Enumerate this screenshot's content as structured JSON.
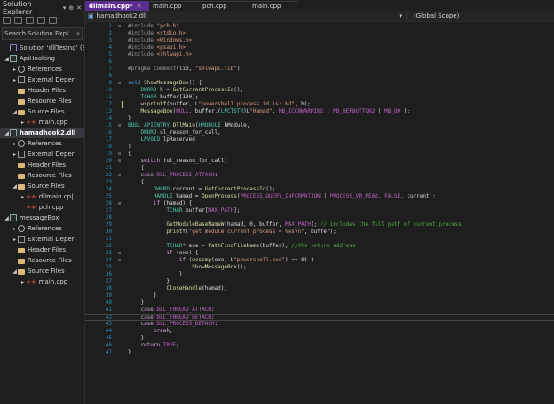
{
  "solution_explorer": {
    "title": "Solution Explorer",
    "title_buttons": [
      "▾",
      "⊕",
      "✕"
    ],
    "search_placeholder": "Search Solution Expl",
    "items": [
      {
        "label": "Solution 'dllTestng' (3",
        "indent": 0,
        "arrow": "",
        "icon": "solution",
        "sel": false
      },
      {
        "label": "ApiHooking",
        "indent": 0,
        "arrow": "◢",
        "icon": "project",
        "sel": false
      },
      {
        "label": "References",
        "indent": 1,
        "arrow": "▸",
        "icon": "ref",
        "sel": false
      },
      {
        "label": "External Deper",
        "indent": 1,
        "arrow": "▸",
        "icon": "ext",
        "sel": false
      },
      {
        "label": "Header Files",
        "indent": 1,
        "arrow": "",
        "icon": "folder",
        "sel": false
      },
      {
        "label": "Resource Files",
        "indent": 1,
        "arrow": "",
        "icon": "folder",
        "sel": false
      },
      {
        "label": "Source Files",
        "indent": 1,
        "arrow": "◢",
        "icon": "folder",
        "sel": false
      },
      {
        "label": "main.cpp",
        "indent": 2,
        "arrow": "▸",
        "icon": "cpp",
        "sel": false
      },
      {
        "label": "hamadhook2.dll",
        "indent": 0,
        "arrow": "◢",
        "icon": "project",
        "sel": true,
        "bold": true
      },
      {
        "label": "References",
        "indent": 1,
        "arrow": "▸",
        "icon": "ref",
        "sel": false
      },
      {
        "label": "External Deper",
        "indent": 1,
        "arrow": "▸",
        "icon": "ext",
        "sel": false
      },
      {
        "label": "Header Files",
        "indent": 1,
        "arrow": "",
        "icon": "folder",
        "sel": false
      },
      {
        "label": "Resource Files",
        "indent": 1,
        "arrow": "",
        "icon": "folder",
        "sel": false
      },
      {
        "label": "Source Files",
        "indent": 1,
        "arrow": "◢",
        "icon": "folder",
        "sel": false
      },
      {
        "label": "dllmain.cp|",
        "indent": 2,
        "arrow": "▸",
        "icon": "cpp",
        "sel": false
      },
      {
        "label": "pch.cpp",
        "indent": 2,
        "arrow": "",
        "icon": "cpp",
        "sel": false
      },
      {
        "label": "messageBox",
        "indent": 0,
        "arrow": "◢",
        "icon": "project",
        "sel": false
      },
      {
        "label": "References",
        "indent": 1,
        "arrow": "▸",
        "icon": "ref",
        "sel": false
      },
      {
        "label": "External Deper",
        "indent": 1,
        "arrow": "▸",
        "icon": "ext",
        "sel": false
      },
      {
        "label": "Header Files",
        "indent": 1,
        "arrow": "",
        "icon": "folder",
        "sel": false
      },
      {
        "label": "Resource Files",
        "indent": 1,
        "arrow": "",
        "icon": "folder",
        "sel": false
      },
      {
        "label": "Source Files",
        "indent": 1,
        "arrow": "◢",
        "icon": "folder",
        "sel": false
      },
      {
        "label": "main.cpp",
        "indent": 2,
        "arrow": "▸",
        "icon": "cpp",
        "sel": false
      }
    ]
  },
  "tabs": [
    {
      "label": "dllmain.cpp*",
      "active": true
    },
    {
      "label": "main.cpp",
      "active": false
    },
    {
      "label": "pch.cpp",
      "active": false
    },
    {
      "label": "main.cpp",
      "active": false
    }
  ],
  "navbar": {
    "file": "hamadhook2.dll",
    "scope": "(Global Scope)"
  },
  "lines": [
    {
      "n": 1,
      "fold": "⊟",
      "tokens": [
        [
          "p",
          "#include "
        ],
        [
          "s",
          "\"pch.h\""
        ]
      ]
    },
    {
      "n": 2,
      "tokens": [
        [
          "p",
          "#include "
        ],
        [
          "s",
          "<stdio.h>"
        ]
      ]
    },
    {
      "n": 3,
      "tokens": [
        [
          "p",
          "#include "
        ],
        [
          "s",
          "<Windows.h>"
        ]
      ]
    },
    {
      "n": 4,
      "tokens": [
        [
          "p",
          "#include "
        ],
        [
          "s",
          "<psapi.h>"
        ]
      ]
    },
    {
      "n": 5,
      "tokens": [
        [
          "p",
          "#include "
        ],
        [
          "s",
          "<shlwapi.h>"
        ]
      ]
    },
    {
      "n": 6,
      "tokens": []
    },
    {
      "n": 7,
      "tokens": [
        [
          "p",
          "#pragma comment"
        ],
        [
          "",
          "(lib, "
        ],
        [
          "s",
          "\"shlwapi.lib\""
        ],
        [
          "",
          ")"
        ]
      ]
    },
    {
      "n": 8,
      "tokens": []
    },
    {
      "n": 9,
      "fold": "⊟",
      "tokens": [
        [
          "k",
          "void "
        ],
        [
          "f",
          "ShowMessageBox"
        ],
        [
          "",
          "() {"
        ]
      ]
    },
    {
      "n": 10,
      "tokens": [
        [
          "",
          "    "
        ],
        [
          "t",
          "DWORD"
        ],
        [
          "",
          " h = "
        ],
        [
          "f",
          "GetCurrentProcessId"
        ],
        [
          "",
          "();"
        ]
      ]
    },
    {
      "n": 11,
      "tokens": [
        [
          "",
          "    "
        ],
        [
          "t",
          "TCHAR"
        ],
        [
          "",
          " buffer[100];"
        ]
      ]
    },
    {
      "n": 12,
      "bar": true,
      "tokens": [
        [
          "",
          "    "
        ],
        [
          "f",
          "wsprintf"
        ],
        [
          "",
          "(buffer, L"
        ],
        [
          "s",
          "\"powershell process id is: %d\""
        ],
        [
          "",
          ", h);"
        ]
      ]
    },
    {
      "n": 13,
      "tokens": [
        [
          "",
          "    "
        ],
        [
          "f",
          "MessageBox"
        ],
        [
          "",
          "("
        ],
        [
          "m",
          "NULL"
        ],
        [
          "",
          ", buffer,("
        ],
        [
          "t",
          "LPCTSTR"
        ],
        [
          "",
          ")L"
        ],
        [
          "s",
          "\"Hamad\""
        ],
        [
          "",
          ", "
        ],
        [
          "m",
          "MB_ICONWARNING"
        ],
        [
          "",
          " | "
        ],
        [
          "m",
          "MB_DEFBUTTON2"
        ],
        [
          "",
          " | "
        ],
        [
          "m",
          "MB_OK"
        ],
        [
          "",
          " );"
        ]
      ]
    },
    {
      "n": 14,
      "tokens": [
        [
          "",
          "}"
        ]
      ]
    },
    {
      "n": 15,
      "fold": "⊟",
      "tokens": [
        [
          "t",
          "BOOL"
        ],
        [
          "",
          " "
        ],
        [
          "t",
          "APIENTRY"
        ],
        [
          "",
          " "
        ],
        [
          "f",
          "DllMain"
        ],
        [
          "",
          "("
        ],
        [
          "t",
          "HMODULE"
        ],
        [
          "",
          " hModule,"
        ]
      ]
    },
    {
      "n": 16,
      "tokens": [
        [
          "",
          "    "
        ],
        [
          "t",
          "DWORD"
        ],
        [
          "",
          " ul_reason_for_call,"
        ]
      ]
    },
    {
      "n": 17,
      "tokens": [
        [
          "",
          "    "
        ],
        [
          "t",
          "LPVOID"
        ],
        [
          "",
          " lpReserved"
        ]
      ]
    },
    {
      "n": 18,
      "tokens": [
        [
          "",
          ")"
        ]
      ]
    },
    {
      "n": 19,
      "fold": "⊟",
      "tokens": [
        [
          "",
          "{"
        ]
      ]
    },
    {
      "n": 20,
      "fold": "⊟",
      "tokens": [
        [
          "",
          "    "
        ],
        [
          "kc",
          "switch"
        ],
        [
          "",
          " (ul_reason_for_call)"
        ]
      ]
    },
    {
      "n": 21,
      "tokens": [
        [
          "",
          "    {"
        ]
      ]
    },
    {
      "n": 22,
      "fold": "⊟",
      "tokens": [
        [
          "",
          "    "
        ],
        [
          "kc",
          "case"
        ],
        [
          "",
          " "
        ],
        [
          "m",
          "DLL_PROCESS_ATTACH"
        ],
        [
          "",
          ":"
        ]
      ]
    },
    {
      "n": 23,
      "tokens": [
        [
          "",
          "    {"
        ]
      ]
    },
    {
      "n": 24,
      "tokens": [
        [
          "",
          "        "
        ],
        [
          "t",
          "DWORD"
        ],
        [
          "",
          " current = "
        ],
        [
          "f",
          "GetCurrentProcessId"
        ],
        [
          "",
          "();"
        ]
      ]
    },
    {
      "n": 25,
      "tokens": [
        [
          "",
          "        "
        ],
        [
          "t",
          "HANDLE"
        ],
        [
          "",
          " hamad = "
        ],
        [
          "f",
          "OpenProcess"
        ],
        [
          "",
          "("
        ],
        [
          "m",
          "PROCESS_QUERY_INFORMATION"
        ],
        [
          "",
          " | "
        ],
        [
          "m",
          "PROCESS_VM_READ"
        ],
        [
          "",
          ", "
        ],
        [
          "m",
          "FALSE"
        ],
        [
          "",
          ", current);"
        ]
      ]
    },
    {
      "n": 26,
      "fold": "⊟",
      "tokens": [
        [
          "",
          "        "
        ],
        [
          "kc",
          "if"
        ],
        [
          "",
          " (hamad) {"
        ]
      ]
    },
    {
      "n": 27,
      "tokens": [
        [
          "",
          "            "
        ],
        [
          "t",
          "TCHAR"
        ],
        [
          "",
          " buffer["
        ],
        [
          "m",
          "MAX_PATH"
        ],
        [
          "",
          "];"
        ]
      ]
    },
    {
      "n": 28,
      "tokens": []
    },
    {
      "n": 29,
      "tokens": [
        [
          "",
          "            "
        ],
        [
          "f",
          "GetModuleBaseNameW"
        ],
        [
          "",
          "(hamad, 0, buffer, "
        ],
        [
          "m",
          "MAX_PATH"
        ],
        [
          "",
          "); "
        ],
        [
          "c",
          "// includes the full path of current process"
        ]
      ]
    },
    {
      "n": 30,
      "tokens": [
        [
          "",
          "            "
        ],
        [
          "f",
          "printf"
        ],
        [
          "",
          "("
        ],
        [
          "s",
          "\"get module current process = %ws\\n\""
        ],
        [
          "",
          ", buffer);"
        ]
      ]
    },
    {
      "n": 31,
      "tokens": []
    },
    {
      "n": 32,
      "tokens": [
        [
          "",
          "            "
        ],
        [
          "t",
          "TCHAR"
        ],
        [
          "",
          "* exe = "
        ],
        [
          "f",
          "PathFindFileName"
        ],
        [
          "",
          "(buffer); "
        ],
        [
          "c",
          "//the return address"
        ]
      ]
    },
    {
      "n": 33,
      "fold": "⊟",
      "tokens": [
        [
          "",
          "            "
        ],
        [
          "kc",
          "if"
        ],
        [
          "",
          " (exe) {"
        ]
      ]
    },
    {
      "n": 34,
      "fold": "⊟",
      "tokens": [
        [
          "",
          "                "
        ],
        [
          "kc",
          "if"
        ],
        [
          "",
          " ("
        ],
        [
          "f",
          "wcscmp"
        ],
        [
          "",
          "(exe, L"
        ],
        [
          "s",
          "\"powershell.exe\""
        ],
        [
          "",
          ") == 0) {"
        ]
      ]
    },
    {
      "n": 35,
      "tokens": [
        [
          "",
          "                    "
        ],
        [
          "f",
          "ShowMessageBox"
        ],
        [
          "",
          "();"
        ]
      ]
    },
    {
      "n": 36,
      "tokens": [
        [
          "",
          "                }"
        ]
      ]
    },
    {
      "n": 37,
      "tokens": [
        [
          "",
          "            }"
        ]
      ]
    },
    {
      "n": 38,
      "tokens": [
        [
          "",
          "            "
        ],
        [
          "f",
          "CloseHandle"
        ],
        [
          "",
          "(hamad);"
        ]
      ]
    },
    {
      "n": 39,
      "tokens": [
        [
          "",
          "        }"
        ]
      ]
    },
    {
      "n": 40,
      "tokens": [
        [
          "",
          "    }"
        ]
      ]
    },
    {
      "n": 41,
      "tokens": [
        [
          "",
          "    "
        ],
        [
          "kc",
          "case"
        ],
        [
          "",
          " "
        ],
        [
          "m",
          "DLL_THREAD_ATTACH"
        ],
        [
          "",
          ":"
        ]
      ]
    },
    {
      "n": 42,
      "cur": true,
      "tokens": [
        [
          "",
          "    "
        ],
        [
          "kc",
          "case"
        ],
        [
          "",
          " "
        ],
        [
          "m",
          "DLL_THREAD_DETACH"
        ],
        [
          "",
          ":"
        ]
      ]
    },
    {
      "n": 43,
      "tokens": [
        [
          "",
          "    "
        ],
        [
          "kc",
          "case"
        ],
        [
          "",
          " "
        ],
        [
          "m",
          "DLL_PROCESS_DETACH"
        ],
        [
          "",
          ":"
        ]
      ]
    },
    {
      "n": 44,
      "tokens": [
        [
          "",
          "        "
        ],
        [
          "kc",
          "break"
        ],
        [
          "",
          ";"
        ]
      ]
    },
    {
      "n": 45,
      "tokens": [
        [
          "",
          "    }"
        ]
      ]
    },
    {
      "n": 46,
      "tokens": [
        [
          "",
          "    "
        ],
        [
          "kc",
          "return"
        ],
        [
          "",
          " "
        ],
        [
          "m",
          "TRUE"
        ],
        [
          "",
          ";"
        ]
      ]
    },
    {
      "n": 47,
      "tokens": [
        [
          "",
          "}"
        ]
      ]
    }
  ],
  "colors": {
    "accent": "#b48ee0",
    "line_number": "#2b91af",
    "background": "#1e1e1e"
  }
}
